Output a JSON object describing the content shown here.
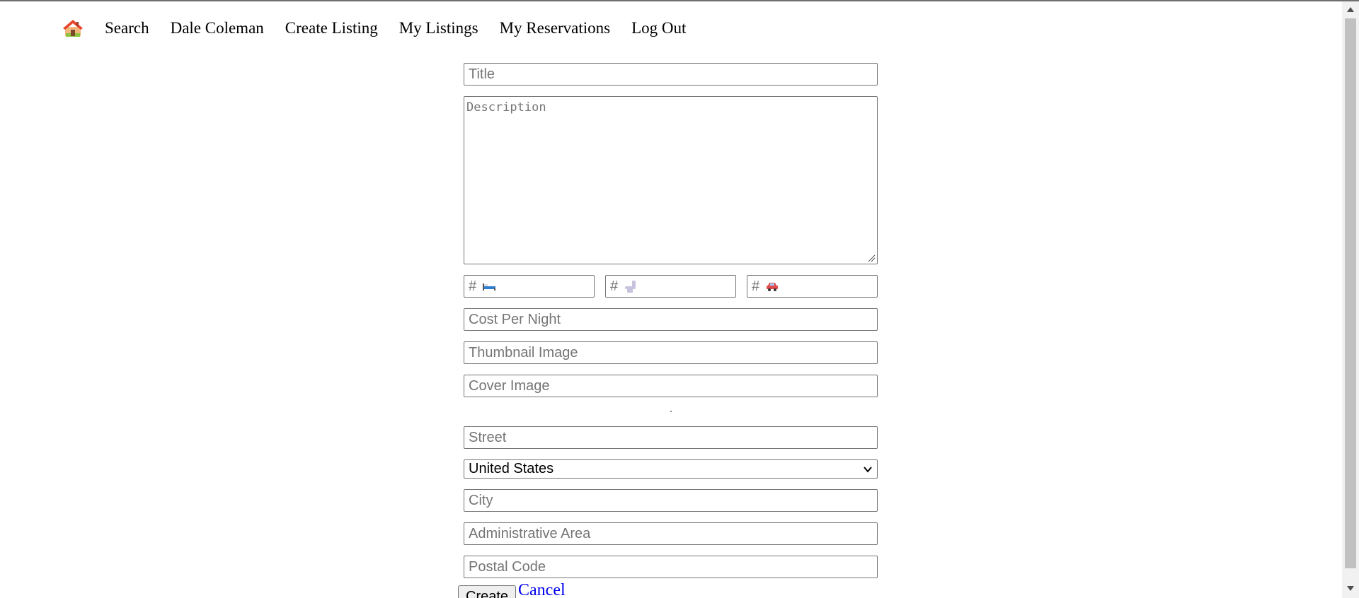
{
  "nav": {
    "home_icon": "house-emoji-icon",
    "links": [
      "Search",
      "Dale Coleman",
      "Create Listing",
      "My Listings",
      "My Reservations",
      "Log Out"
    ]
  },
  "form": {
    "title_placeholder": "Title",
    "description_placeholder": "Description",
    "bedrooms": {
      "prefix": "#",
      "icon": "bed-icon"
    },
    "bathrooms": {
      "prefix": "#",
      "icon": "toilet-icon"
    },
    "parking": {
      "prefix": "#",
      "icon": "car-icon"
    },
    "cost_placeholder": "Cost Per Night",
    "thumbnail_placeholder": "Thumbnail Image",
    "cover_placeholder": "Cover Image",
    "street_placeholder": "Street",
    "country_selected": "United States",
    "city_placeholder": "City",
    "admin_area_placeholder": "Administrative Area",
    "postal_code_placeholder": "Postal Code",
    "create_label": "Create",
    "cancel_label": "Cancel"
  },
  "colors": {
    "link": "#0000ee",
    "input_border": "#767676",
    "placeholder": "#757575"
  }
}
